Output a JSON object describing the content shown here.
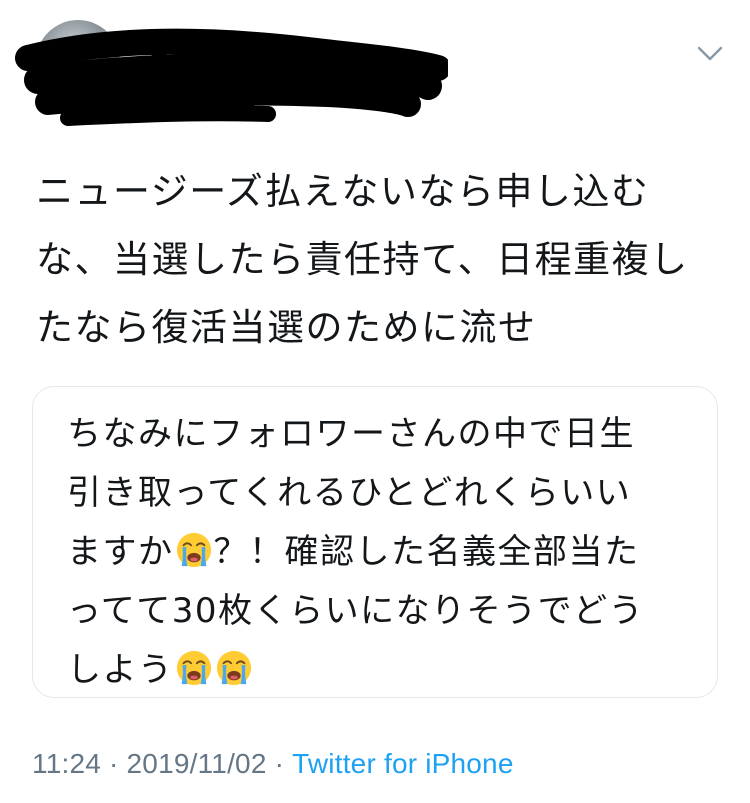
{
  "tweet": {
    "text": "ニュージーズ払えないなら申し込むな、当選したら責任持て、日程重複したなら復活当選のために流せ"
  },
  "quoted_tweet": {
    "text_lines": [
      "ちなみにフォロワーさんの中で日生",
      "引き取ってくれるひとどれくらいい",
      "ますか",
      "？！確認した名義全部当た",
      "ってて30枚くらいになりそうでどう",
      "しよう"
    ]
  },
  "footer": {
    "time": "11:24",
    "separator": "·",
    "date": "2019/11/02",
    "source": "Twitter for iPhone"
  },
  "icons": {
    "more": "chevron-down-icon",
    "emoji": "loudly-crying-face-emoji"
  },
  "colors": {
    "text": "#14171a",
    "secondary": "#657786",
    "link": "#1da1f2",
    "border": "#e1e8ed"
  }
}
